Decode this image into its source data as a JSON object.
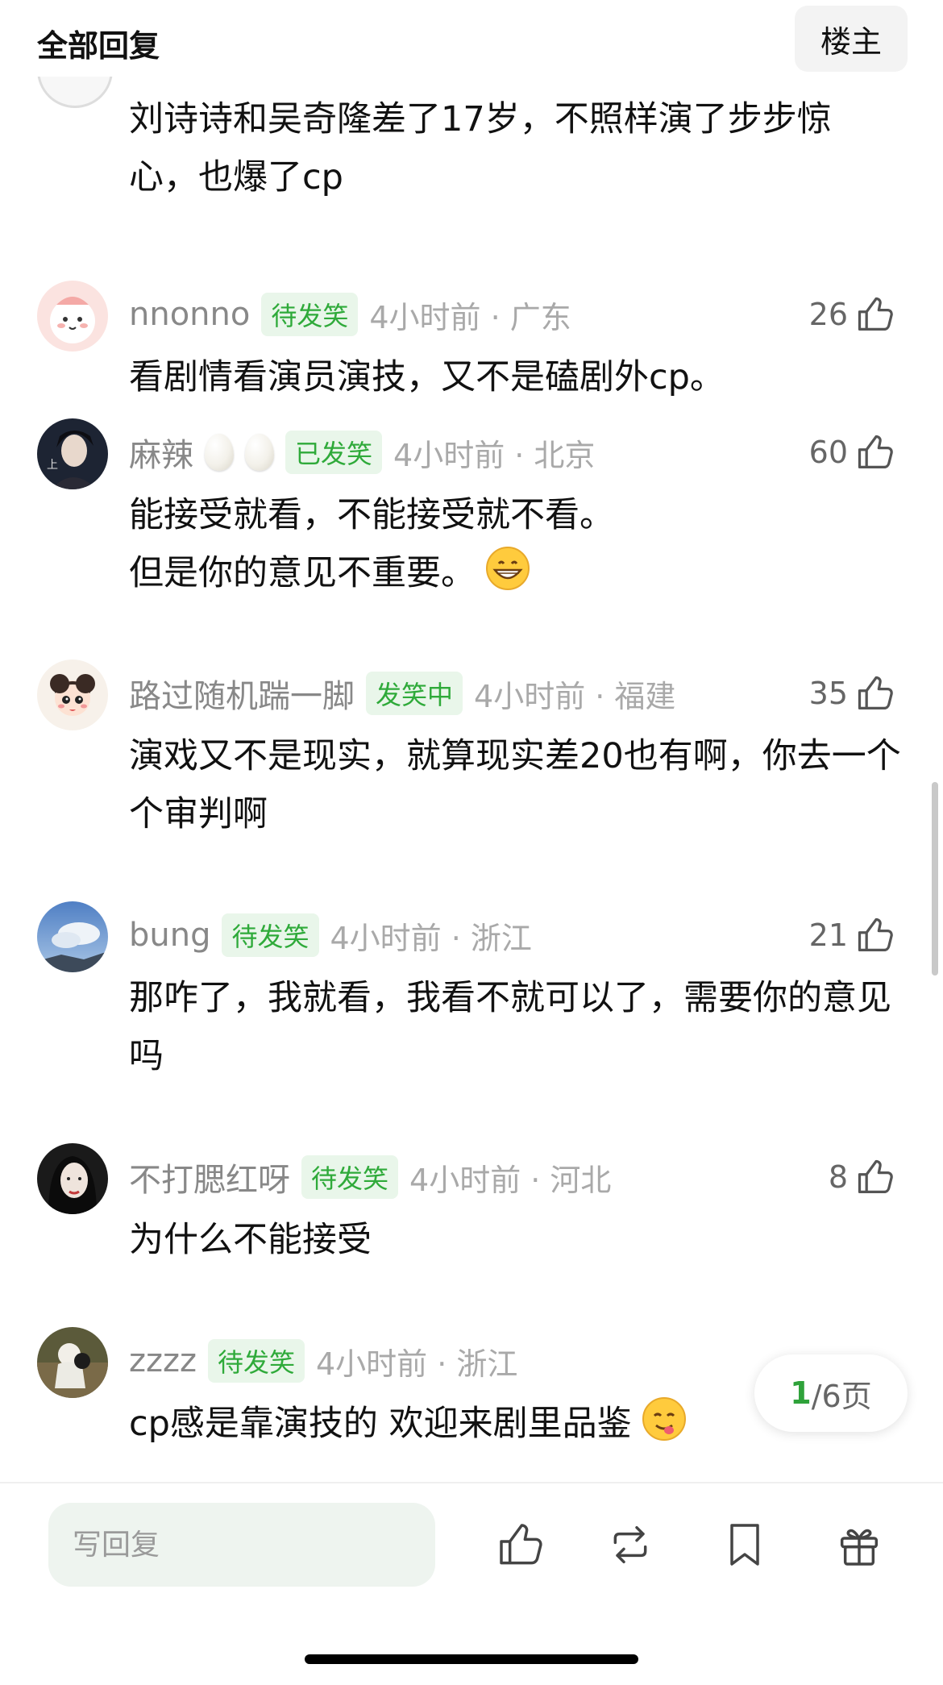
{
  "header": {
    "title": "全部回复",
    "owner_button": "楼主"
  },
  "partial_comment": {
    "text": "刘诗诗和吴奇隆差了17岁，不照样演了步步惊心，也爆了cp"
  },
  "comments": [
    {
      "username": "nnonno",
      "badge": "待发笑",
      "time": "4小时前 · 广东",
      "likes": "26",
      "eggs": 0,
      "lines": [
        "看剧情看演员演技，又不是磕剧外cp。"
      ],
      "emoji": null
    },
    {
      "username": "麻辣",
      "badge": "已发笑",
      "time": "4小时前 · 北京",
      "likes": "60",
      "eggs": 2,
      "lines": [
        "能接受就看，不能接受就不看。",
        "但是你的意见不重要。"
      ],
      "emoji": "grin-emoji"
    },
    {
      "username": "路过随机踹一脚",
      "badge": "发笑中",
      "time": "4小时前 · 福建",
      "likes": "35",
      "eggs": 0,
      "lines": [
        "演戏又不是现实，就算现实差20也有啊，你去一个个审判啊"
      ],
      "emoji": null
    },
    {
      "username": "bung",
      "badge": "待发笑",
      "time": "4小时前 · 浙江",
      "likes": "21",
      "eggs": 0,
      "lines": [
        "那咋了，我就看，我看不就可以了，需要你的意见吗"
      ],
      "emoji": null
    },
    {
      "username": "不打腮红呀",
      "badge": "待发笑",
      "time": "4小时前 · 河北",
      "likes": "8",
      "eggs": 0,
      "lines": [
        "为什么不能接受"
      ],
      "emoji": null
    },
    {
      "username": "zzzz",
      "badge": "待发笑",
      "time": "4小时前 · 浙江",
      "likes": "",
      "eggs": 0,
      "lines": [
        "cp感是靠演技的 欢迎来剧里品鉴"
      ],
      "emoji": "yum-emoji"
    }
  ],
  "pagination": {
    "current": "1",
    "total_text": "/6页"
  },
  "bottom_bar": {
    "reply_placeholder": "写回复",
    "icons": [
      "thumbs-up-icon",
      "repost-icon",
      "bookmark-icon",
      "gift-icon"
    ]
  },
  "colors": {
    "badge_green": "#2faa3a",
    "badge_bg": "#e9f6ea",
    "input_bg": "#eef4ef"
  }
}
